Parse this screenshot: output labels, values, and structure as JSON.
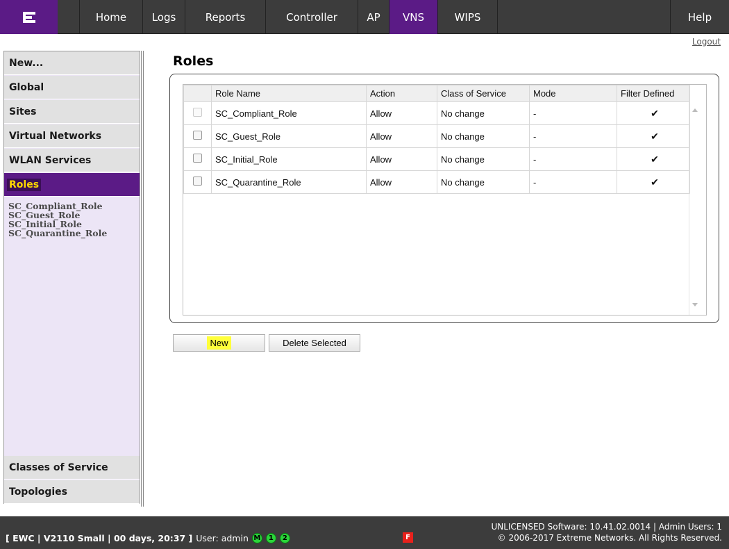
{
  "nav": {
    "tabs": [
      "Home",
      "Logs",
      "Reports",
      "Controller",
      "AP",
      "VNS",
      "WIPS",
      "Help"
    ],
    "active_tab": "VNS",
    "logout": "Logout"
  },
  "sidebar": {
    "items": [
      "New...",
      "Global",
      "Sites",
      "Virtual Networks",
      "WLAN Services",
      "Roles",
      "Classes of Service",
      "Topologies"
    ],
    "active": "Roles",
    "roles_sublist": [
      "SC_Compliant_Role",
      "SC_Guest_Role",
      "SC_Initial_Role",
      "SC_Quarantine_Role"
    ]
  },
  "main": {
    "title": "Roles",
    "table": {
      "headers": [
        "Role Name",
        "Action",
        "Class of Service",
        "Mode",
        "Filter Defined"
      ],
      "rows": [
        {
          "name": "SC_Compliant_Role",
          "action": "Allow",
          "cos": "No change",
          "mode": "-",
          "filter": "✔",
          "checkbox_disabled": true
        },
        {
          "name": "SC_Guest_Role",
          "action": "Allow",
          "cos": "No change",
          "mode": "-",
          "filter": "✔",
          "checkbox_disabled": false
        },
        {
          "name": "SC_Initial_Role",
          "action": "Allow",
          "cos": "No change",
          "mode": "-",
          "filter": "✔",
          "checkbox_disabled": false
        },
        {
          "name": "SC_Quarantine_Role",
          "action": "Allow",
          "cos": "No change",
          "mode": "-",
          "filter": "✔",
          "checkbox_disabled": false
        }
      ]
    },
    "buttons": {
      "new": "New",
      "delete": "Delete Selected"
    }
  },
  "status": {
    "system": "[ EWC | V2110 Small | 00 days, 20:37 ]",
    "user": "User: admin",
    "indicators": [
      "M",
      "1",
      "2"
    ],
    "flag": "F",
    "license": "UNLICENSED Software: 10.41.02.0014 | Admin Users: 1",
    "copyright": "© 2006-2017  Extreme Networks. All Rights Reserved."
  },
  "colors": {
    "brand": "#5b1b86",
    "highlight": "#ffd800",
    "status_green": "#2bd43a",
    "alert_red": "#e8211c"
  }
}
